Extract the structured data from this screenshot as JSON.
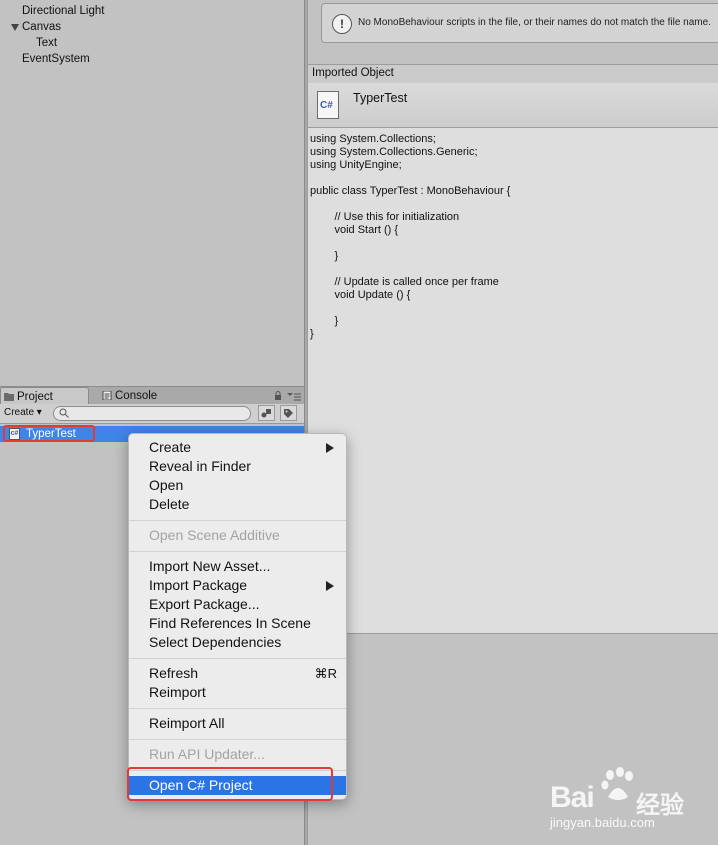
{
  "hierarchy": {
    "items": [
      {
        "label": "Directional Light"
      },
      {
        "label": "Canvas"
      },
      {
        "label": "Text"
      },
      {
        "label": "EventSystem"
      }
    ]
  },
  "project_panel": {
    "tabs": [
      {
        "label": "Project",
        "icon": "folder-icon",
        "active": true
      },
      {
        "label": "Console",
        "icon": "console-icon",
        "active": false
      }
    ],
    "create_label": "Create ▾",
    "asset": {
      "label": "TyperTest",
      "icon": "csharp-script-icon"
    }
  },
  "inspector": {
    "help_text": "No MonoBehaviour scripts in the file, or their names do not match the file name.",
    "imported_object_label": "Imported Object",
    "asset_name": "TyperTest",
    "asset_icon_text": "C#",
    "code": "using System.Collections;\nusing System.Collections.Generic;\nusing UnityEngine;\n\npublic class TyperTest : MonoBehaviour {\n\n\t\t// Use this for initialization\n\t\tvoid Start () {\n\n\t\t}\n\n\t\t// Update is called once per frame\n\t\tvoid Update () {\n\n\t\t}\n}"
  },
  "context_menu": {
    "items": [
      {
        "label": "Create",
        "submenu": true
      },
      {
        "label": "Reveal in Finder"
      },
      {
        "label": "Open"
      },
      {
        "label": "Delete"
      },
      {
        "label": "Open Scene Additive",
        "disabled": true
      },
      {
        "label": "Import New Asset..."
      },
      {
        "label": "Import Package",
        "submenu": true
      },
      {
        "label": "Export Package..."
      },
      {
        "label": "Find References In Scene"
      },
      {
        "label": "Select Dependencies"
      },
      {
        "label": "Refresh",
        "shortcut": "⌘R"
      },
      {
        "label": "Reimport"
      },
      {
        "label": "Reimport All"
      },
      {
        "label": "Run API Updater...",
        "disabled": true
      },
      {
        "label": "Open C# Project",
        "selected": true
      }
    ]
  },
  "watermark": {
    "brand": "Bai",
    "brand2": "经验",
    "url": "jingyan.baidu.com"
  },
  "colors": {
    "selection_blue": "#2a74e6",
    "highlight_red": "#e53935",
    "panel_gray": "#c2c2c2"
  }
}
